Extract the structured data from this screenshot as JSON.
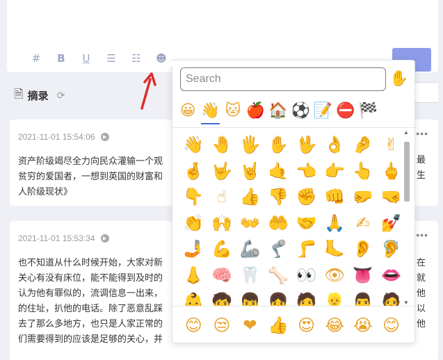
{
  "toolbar": {
    "items": [
      {
        "name": "hashtag-button",
        "icon": "#",
        "cls": ""
      },
      {
        "name": "bold-button",
        "icon": "B",
        "cls": "bold"
      },
      {
        "name": "underline-button",
        "icon": "U",
        "cls": "underline"
      },
      {
        "name": "bullet-list-button",
        "icon": "☰",
        "cls": ""
      },
      {
        "name": "numbered-list-button",
        "icon": "☷",
        "cls": ""
      },
      {
        "name": "emoji-button",
        "icon": "☻",
        "cls": ""
      }
    ]
  },
  "section": {
    "title": "摘录",
    "doc_icon": "🗎",
    "refresh_icon": "⟳"
  },
  "notes": [
    {
      "time": "2021-11-01 15:54:06",
      "text": "资产阶级竭尽全力向民众灌输一个观\n贫穷的爱国者，一想到英国的财富和\n人阶级现状》"
    },
    {
      "time": "2021-11-01 15:53:34",
      "text": "也不知道从什么时候开始，大家对新\n关心有没有床位，能不能得到及时的\n认为他有罪似的，流调信息一出来，\n的住址，扒他的电话。除了恶意乱踩\n去了那么多地方，也只是人家正常的\n们需要得到的应该是足够的关心，并"
    }
  ],
  "right_fragments": {
    "card1": "最\n生",
    "card2": "在\n就\n他\n以\n他"
  },
  "more_icon": "•••",
  "play_icon": "▶",
  "emoji_picker": {
    "search_placeholder": "Search",
    "skin_tone_icon": "✋",
    "categories": [
      {
        "name": "smileys",
        "icon": "😀"
      },
      {
        "name": "people",
        "icon": "👋"
      },
      {
        "name": "animals",
        "icon": "🐱"
      },
      {
        "name": "food",
        "icon": "🍎"
      },
      {
        "name": "travel",
        "icon": "🏠"
      },
      {
        "name": "activities",
        "icon": "⚽"
      },
      {
        "name": "objects",
        "icon": "📝"
      },
      {
        "name": "symbols",
        "icon": "⛔"
      },
      {
        "name": "flags",
        "icon": "🏁"
      }
    ],
    "active_category": 1,
    "grid": [
      "👋",
      "🤚",
      "🖐",
      "✋",
      "🖖",
      "👌",
      "🤌",
      "✌",
      "🤞",
      "🤟",
      "🤘",
      "🤙",
      "👈",
      "👉",
      "👆",
      "🖕",
      "👇",
      "☝",
      "👍",
      "👎",
      "✊",
      "👊",
      "🤛",
      "🤜",
      "👏",
      "🙌",
      "👐",
      "🤲",
      "🤝",
      "🙏",
      "✍",
      "💅",
      "🤳",
      "💪",
      "🦾",
      "🦿",
      "🦵",
      "🦶",
      "👂",
      "🦻",
      "👃",
      "🧠",
      "🦷",
      "🦴",
      "👀",
      "👁",
      "👅",
      "👄",
      "👶",
      "🧒",
      "👦",
      "👧",
      "🧑",
      "👱",
      "👨",
      "🧔"
    ],
    "recent": [
      "😊",
      "😒",
      "❤",
      "👍",
      "😍",
      "😂",
      "😭",
      "😊"
    ]
  }
}
